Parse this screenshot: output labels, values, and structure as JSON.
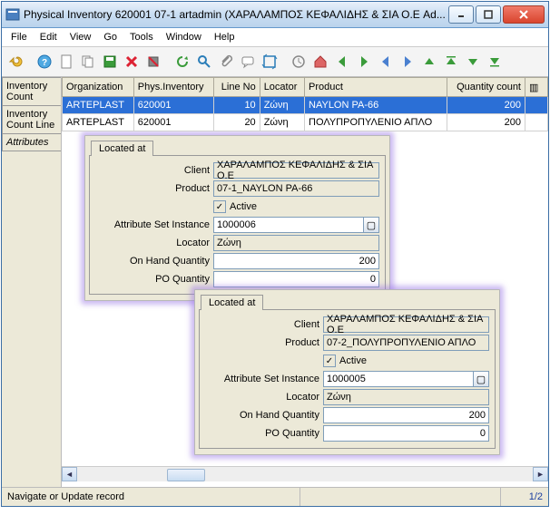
{
  "window": {
    "title": "Physical Inventory  620001  07-1  artadmin (ΧΑΡΑΛΑΜΠΟΣ ΚΕΦΑΛΙΔΗΣ & ΣΙΑ Ο.Ε Ad..."
  },
  "menu": {
    "file": "File",
    "edit": "Edit",
    "view": "View",
    "go": "Go",
    "tools": "Tools",
    "window": "Window",
    "help": "Help"
  },
  "lefttabs": {
    "count": "Inventory Count",
    "line": "Inventory Count Line",
    "attr": "Attributes"
  },
  "grid": {
    "headers": {
      "org": "Organization",
      "phys": "Phys.Inventory",
      "line": "Line No",
      "loc": "Locator",
      "prod": "Product",
      "qty": "Quantity count"
    },
    "rows": [
      {
        "org": "ARTEPLAST",
        "phys": "620001",
        "line": "10",
        "loc": "Ζώνη",
        "prod": "NAYLON PA-66",
        "qty": "200"
      },
      {
        "org": "ARTEPLAST",
        "phys": "620001",
        "line": "20",
        "loc": "Ζώνη",
        "prod": "ΠΟΛΥΠΡΟΠΥΛΕΝΙΟ ΑΠΛΟ",
        "qty": "200"
      }
    ]
  },
  "card_labels": {
    "tab": "Located at",
    "client": "Client",
    "product": "Product",
    "active": "Active",
    "asi": "Attribute Set Instance",
    "locator": "Locator",
    "onhand": "On Hand Quantity",
    "poqty": "PO Quantity"
  },
  "card1": {
    "client": "ΧΑΡΑΛΑΜΠΟΣ ΚΕΦΑΛΙΔΗΣ & ΣΙΑ Ο.Ε",
    "product": "07-1_NAYLON PA-66",
    "asi": "1000006",
    "locator": "Ζώνη",
    "onhand": "200",
    "poqty": "0"
  },
  "card2": {
    "client": "ΧΑΡΑΛΑΜΠΟΣ ΚΕΦΑΛΙΔΗΣ & ΣΙΑ Ο.Ε",
    "product": "07-2_ΠΟΛΥΠΡΟΠΥΛΕΝΙΟ ΑΠΛΟ",
    "asi": "1000005",
    "locator": "Ζώνη",
    "onhand": "200",
    "poqty": "0"
  },
  "status": {
    "msg": "Navigate or Update record",
    "pos": "1/2"
  }
}
